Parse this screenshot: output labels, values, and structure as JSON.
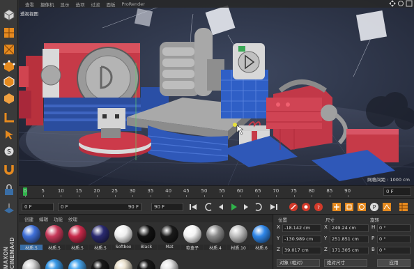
{
  "viewport": {
    "menu": [
      "查看",
      "摄像机",
      "显示",
      "选项",
      "过滤",
      "面板",
      "ProRender"
    ],
    "title": "透视视图",
    "status": "网格间距 : 1000 cm"
  },
  "timeline": {
    "ticks": [
      "0",
      "5",
      "10",
      "15",
      "20",
      "25",
      "30",
      "35",
      "40",
      "45",
      "50",
      "55",
      "60",
      "65",
      "70",
      "75",
      "80",
      "85",
      "90"
    ],
    "frame_end": "0 F"
  },
  "transport": {
    "start_field": "0 F",
    "current_field": "0 F",
    "range_field": "90 F",
    "end_field": "90 F"
  },
  "materials": {
    "menu": [
      "创建",
      "编辑",
      "功能",
      "纹理"
    ],
    "items": [
      {
        "label": "材质.5",
        "color": "#3f6fd8",
        "selected": true
      },
      {
        "label": "材质.5",
        "color": "#c83a5a"
      },
      {
        "label": "材质.5",
        "color": "#c82a4a"
      },
      {
        "label": "材质.5",
        "color": "#2a2a70"
      },
      {
        "label": "Softbox",
        "color": "#eeeeee"
      },
      {
        "label": "Black",
        "color": "#111111"
      },
      {
        "label": "Mat",
        "color": "#1a1a1a"
      },
      {
        "label": "软盒子",
        "color": "#f4f4f4"
      },
      {
        "label": "材质.4",
        "color": "#8a8a8a"
      },
      {
        "label": "材质.10",
        "color": "#bdbdbd"
      },
      {
        "label": "材质.6",
        "color": "#2f86e8"
      }
    ],
    "row2_colors": [
      "#d9d9d9",
      "#3b9be8",
      "#49a8f0",
      "#1b1b1b",
      "#ece3d0",
      "#1a1a1a",
      "#e8e8e8"
    ]
  },
  "coordinates": {
    "headers": {
      "position": "位置",
      "size": "尺寸",
      "rotation": "旋转"
    },
    "rows": [
      {
        "axis": "X",
        "pos": "-18.142 cm",
        "size_axis": "X",
        "size": "249.24 cm",
        "rot_axis": "H",
        "rot": "0 °"
      },
      {
        "axis": "Y",
        "pos": "-130.989 cm",
        "size_axis": "Y",
        "size": "251.851 cm",
        "rot_axis": "P",
        "rot": "0 °"
      },
      {
        "axis": "Z",
        "pos": "39.017 cm",
        "size_axis": "Z",
        "size": "171.305 cm",
        "rot_axis": "B",
        "rot": "0 °"
      }
    ],
    "mode_select": "对象 (相对)",
    "size_select": "绝对尺寸",
    "apply_label": "应用"
  },
  "brand": "MAXON CINEMA4D",
  "colors": {
    "accent_green": "#2fb34a",
    "accent_orange": "#e58a1f",
    "record_red": "#d23a2a"
  }
}
